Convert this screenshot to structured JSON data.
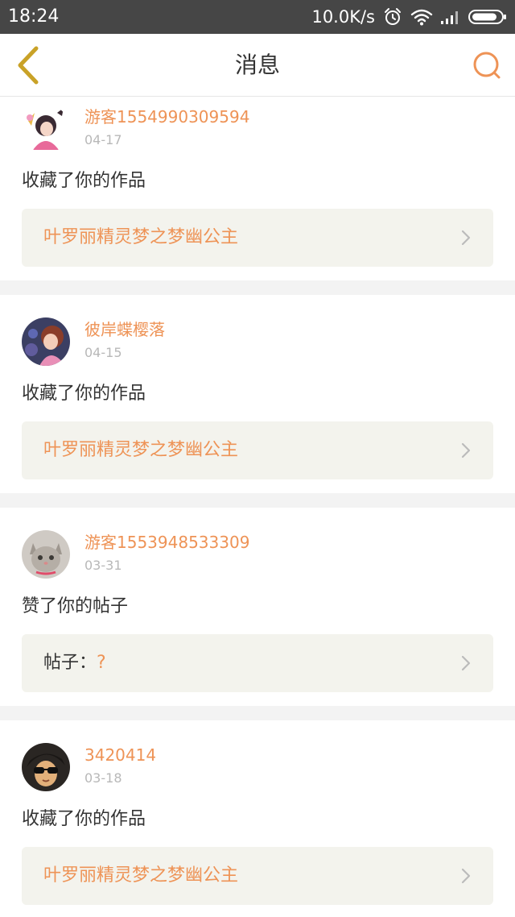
{
  "status_bar": {
    "time": "18:24",
    "network_speed": "10.0K/s",
    "icons": [
      "alarm-icon",
      "wifi-icon",
      "signal-icon",
      "battery-icon"
    ]
  },
  "navbar": {
    "title": "消息",
    "back_icon": "chevron-left-icon",
    "search_icon": "search-icon"
  },
  "colors": {
    "accent": "#ee9356",
    "back_icon": "#c9a227",
    "status_bar_bg": "#464646",
    "card_link_bg": "#f3f3ed",
    "divider_bg": "#f3f3f3"
  },
  "notifications": [
    {
      "username": "游客1554990309594",
      "date": "04-17",
      "action": "收藏了你的作品",
      "link_prefix": "",
      "link_text": "叶罗丽精灵梦之梦幽公主",
      "avatar": "doll-avatar"
    },
    {
      "username": "彼岸蝶樱落",
      "date": "04-15",
      "action": "收藏了你的作品",
      "link_prefix": "",
      "link_text": "叶罗丽精灵梦之梦幽公主",
      "avatar": "doll-avatar"
    },
    {
      "username": "游客1553948533309",
      "date": "03-31",
      "action": "赞了你的帖子",
      "link_prefix": "帖子：",
      "link_text": "?",
      "avatar": "cat-avatar"
    },
    {
      "username": "3420414",
      "date": "03-18",
      "action": "收藏了你的作品",
      "link_prefix": "",
      "link_text": "叶罗丽精灵梦之梦幽公主",
      "avatar": "person-avatar"
    }
  ]
}
